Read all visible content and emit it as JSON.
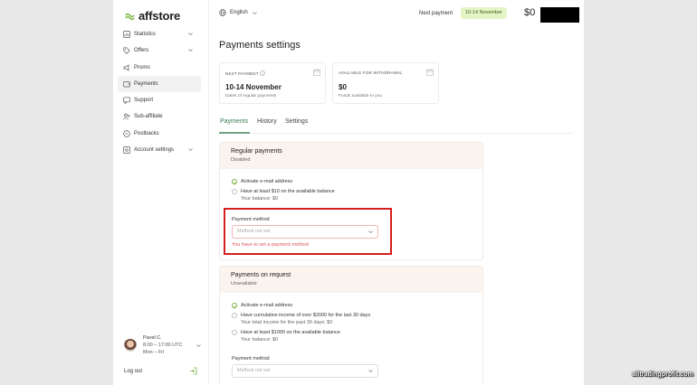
{
  "brand": {
    "name": "affstore",
    "accent": "#7cb342"
  },
  "sidebar": {
    "items": [
      {
        "label": "Statistics",
        "icon": "chart-icon",
        "chevron": true
      },
      {
        "label": "Offers",
        "icon": "tag-icon",
        "chevron": true
      },
      {
        "label": "Promo",
        "icon": "megaphone-icon",
        "chevron": false
      },
      {
        "label": "Payments",
        "icon": "wallet-icon",
        "chevron": false,
        "active": true
      },
      {
        "label": "Support",
        "icon": "chat-icon",
        "chevron": false
      },
      {
        "label": "Sub-affiliate",
        "icon": "user-plus-icon",
        "chevron": false
      },
      {
        "label": "Postbacks",
        "icon": "link-icon",
        "chevron": false
      },
      {
        "label": "Account settings",
        "icon": "gear-icon",
        "chevron": true
      }
    ],
    "user": {
      "name": "Pavel C.",
      "hours": "8:00 – 17:00 UTC",
      "days": "Mon – Fri"
    },
    "logout_label": "Log out"
  },
  "topbar": {
    "language": "English",
    "next_payment_label": "Next payment",
    "next_payment_value": "10-14 November",
    "balance": "$0"
  },
  "page": {
    "title": "Payments settings",
    "cards": [
      {
        "label": "NEXT PAYMENT",
        "value": "10-14 November",
        "sub": "Dates of regular payments"
      },
      {
        "label": "AVAILABLE FOR WITHDRAWAL",
        "value": "$0",
        "sub": "Funds available to you"
      }
    ],
    "tabs": [
      "Payments",
      "History",
      "Settings"
    ],
    "regular": {
      "title": "Regular payments",
      "status": "Disabled",
      "req1": "Activate e-mail address",
      "req2": "Have at least $10 on the available balance",
      "req2_sub": "Your balance: $0",
      "method_label": "Payment method",
      "method_placeholder": "Method not set",
      "error": "You have to set a payment method"
    },
    "on_request": {
      "title": "Payments on request",
      "status": "Unavailable",
      "req1": "Activate e-mail address",
      "req2": "Have cumulative income of over $2000 for the last 30 days",
      "req2_sub": "Your total income for the past 30 days: $0",
      "req3": "Have at least $1000 on the available balance",
      "req3_sub": "Your balance: $0",
      "method_label": "Payment method",
      "method_placeholder": "Method not set"
    }
  },
  "watermark": "alltradingprofit.com"
}
